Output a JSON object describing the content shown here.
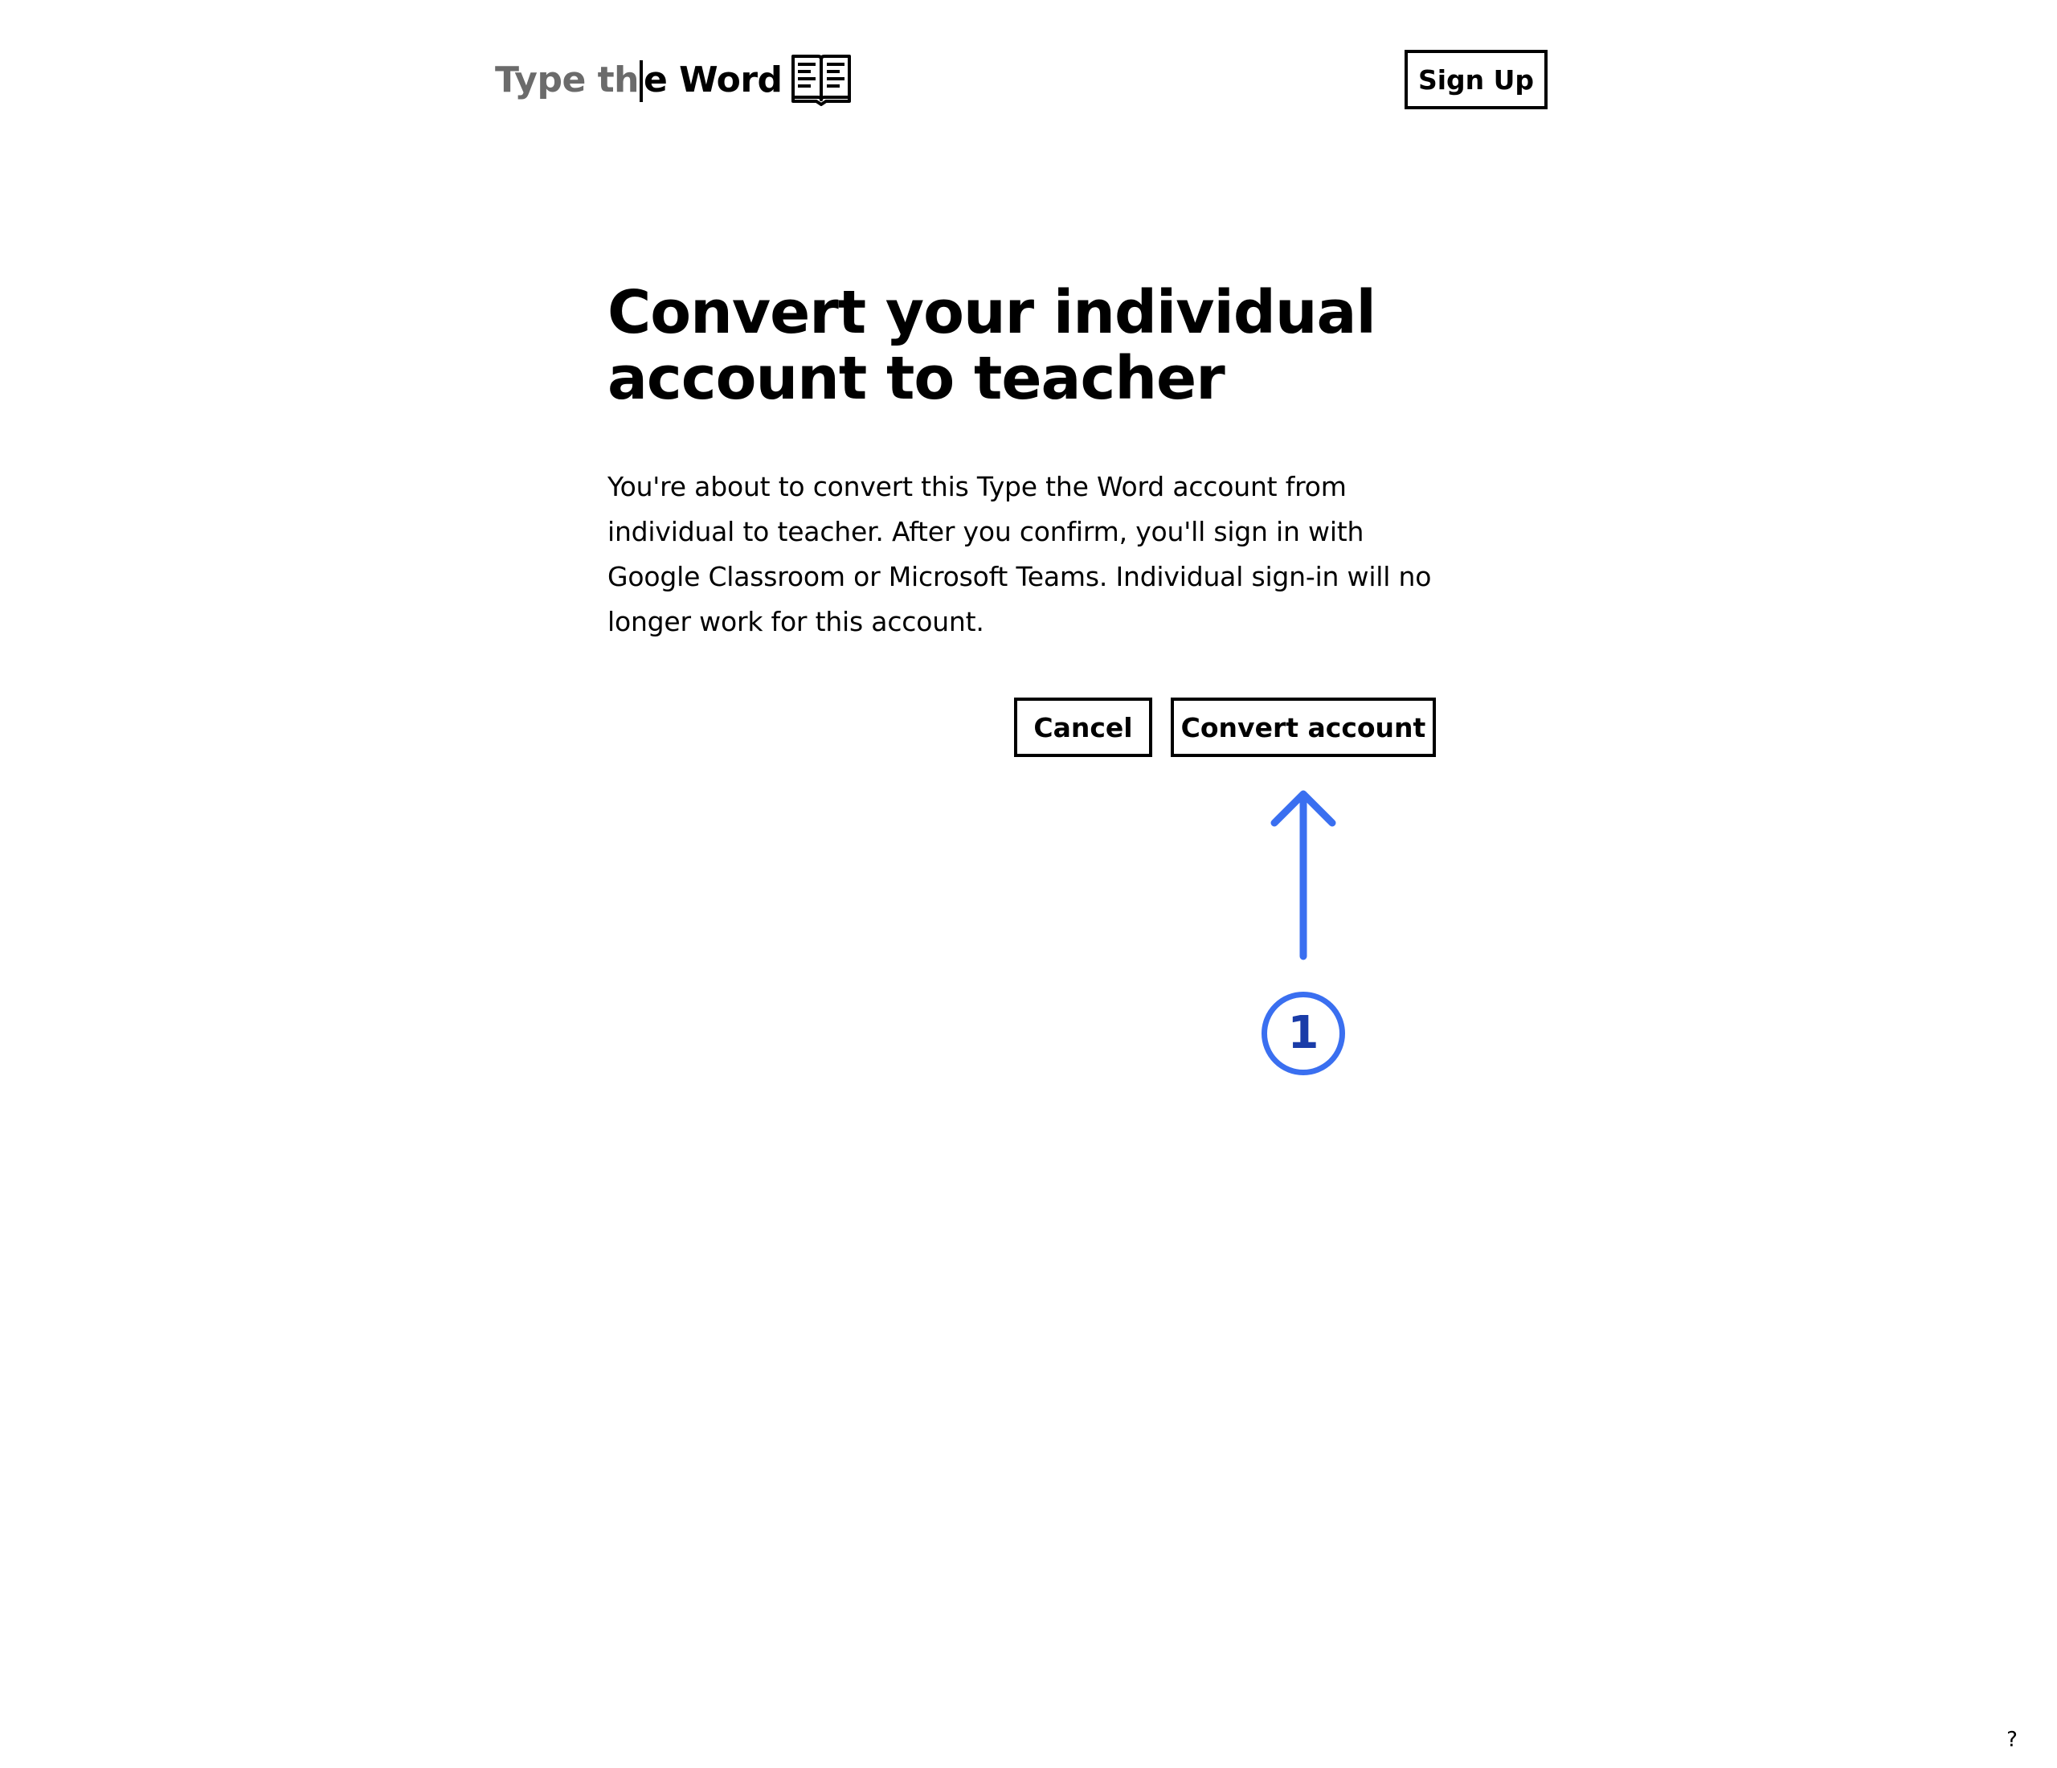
{
  "header": {
    "logo": {
      "typed_text": "Type th",
      "untyped_text": "e Word",
      "icon": "open-book-icon"
    },
    "signup_label": "Sign Up"
  },
  "main": {
    "title_line1": "Convert your individual",
    "title_line2": "account to teacher",
    "body": "You're about to convert this Type the Word account from individual to teacher. After you confirm, you'll sign in with Google Classroom or Microsoft Teams. Individual sign-in will no longer work for this account.",
    "cancel_label": "Cancel",
    "convert_label": "Convert account"
  },
  "annotation": {
    "step_number": "1",
    "arrow_icon": "arrow-up-icon",
    "color": "#3a6ff0"
  },
  "footer": {
    "help_label": "?"
  },
  "colors": {
    "text": "#000000",
    "typed_text": "#6b6b6b",
    "background": "#ffffff",
    "accent": "#3a6ff0"
  }
}
